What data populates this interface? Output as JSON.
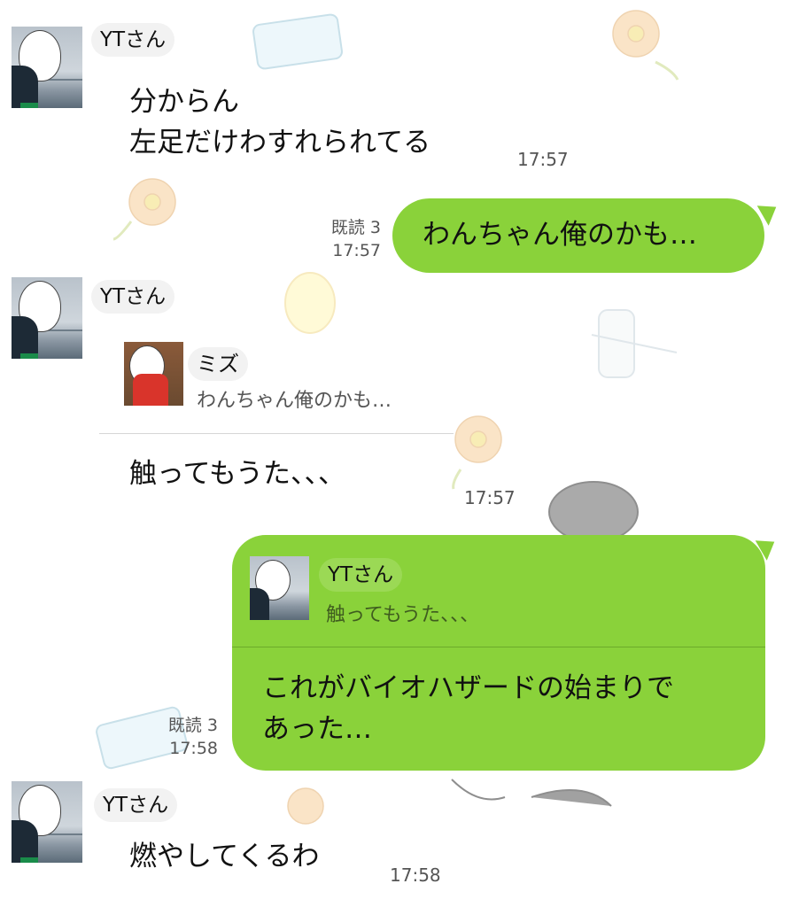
{
  "colors": {
    "bubble_green": "#8ad23a",
    "background": "#ffffff",
    "timestamp_gray": "#555555"
  },
  "messages": [
    {
      "sender": "YTさん",
      "lines": [
        "分からん",
        "左足だけわすれられてる"
      ],
      "time": "17:57"
    },
    {
      "sender": "me",
      "text": "わんちゃん俺のかも…",
      "read": "既読 3",
      "time": "17:57"
    },
    {
      "sender": "YTさん",
      "reply_to": {
        "name": "ミズ",
        "text": "わんちゃん俺のかも…"
      },
      "text": "触ってもうた、、、",
      "time": "17:57"
    },
    {
      "sender": "me",
      "reply_to": {
        "name": "YTさん",
        "text": "触ってもうた、、、"
      },
      "lines": [
        "これがバイオハザードの始まりで",
        "あった…"
      ],
      "read": "既読 3",
      "time": "17:58"
    },
    {
      "sender": "YTさん",
      "text": "燃やしてくるわ",
      "time": "17:58"
    }
  ]
}
